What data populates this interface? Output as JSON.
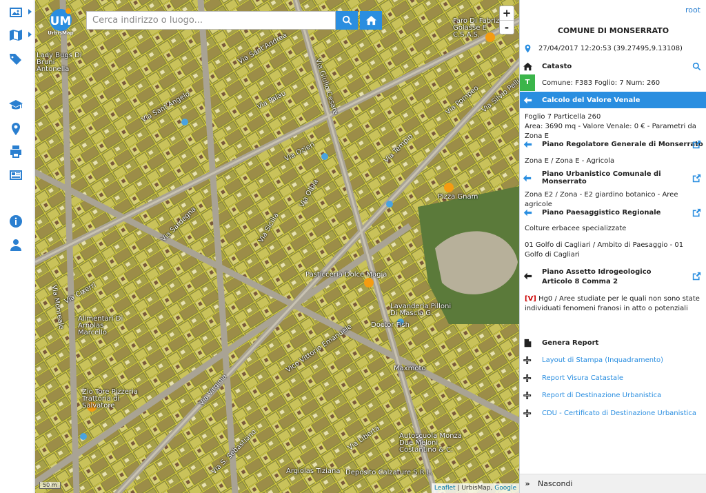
{
  "toolbar": {
    "items": [
      {
        "icon": "image-icon"
      },
      {
        "icon": "map-icon"
      },
      {
        "icon": "tags-icon"
      },
      {
        "icon": "graduation-cap-icon"
      },
      {
        "icon": "map-marker-icon"
      },
      {
        "icon": "print-icon"
      },
      {
        "icon": "newspaper-icon"
      },
      {
        "icon": "info-icon"
      },
      {
        "icon": "user-icon"
      }
    ]
  },
  "map": {
    "logo_text": "UrbisMap",
    "search_placeholder": "Cerca indirizzo o luogo...",
    "zoom_in": "+",
    "zoom_out": "-",
    "scale": "50 m",
    "attribution": {
      "leaflet": "Leaflet",
      "sep1": " | UrbisMap, ",
      "google": "Google"
    },
    "labels": [
      "Faro Di Fabrizio Golasse E C.S.A.S.",
      "Lady Bugs Di Bruni Antonella",
      "Via Giulio Cesare",
      "Via Palau",
      "Via Sant'Andrea",
      "Via Sant'Angelo",
      "Via Olbia",
      "Via Sicilia",
      "Via Ozieri",
      "Via Sardegna",
      "Via Monreale",
      "Via Cixerri",
      "Via Tempio",
      "Via Pompeo",
      "Via Silvio Pellico",
      "Pizza Gnam",
      "Pasticceria Dolce Magia",
      "Alimentari Di Arnolas Marcello",
      "Zio Tore Pizzeria Trattoria di Salvatore",
      "Via Virginia",
      "Via S. Sebastiano",
      "Doctor Fish",
      "Lavanderia Pilloni Di Mascia G.",
      "Maxmoto",
      "Autoscuola Monza Due Meloni Costantino & C.",
      "Argiolas Tiziana",
      "Deposito Calzature S.R.L.",
      "Vico Vittorio Emanuele",
      "Via Liberta"
    ]
  },
  "panel": {
    "user": "root",
    "title": "COMUNE DI MONSERRATO",
    "location": "27/04/2017 12:20:53 (39.27495,9.13108)",
    "catasto_label": "Catasto",
    "catasto_tag": "T",
    "catasto_info": "Comune: F383 Foglio: 7 Num: 260",
    "calc_label": "Calcolo del Valore Venale",
    "calc_line1": "Foglio 7 Particella 260",
    "calc_line2": "Area: 3690 mq - Valore Venale: 0 € - Parametri da Zona E",
    "prg_label": "Piano Regolatore Generale di Monserrato",
    "prg_value": "Zona E / Zona E - Agricola",
    "puc_label": "Piano Urbanistico Comunale di Monserrato",
    "puc_value": "Zona E2 / Zona - E2 giardino botanico - Aree agricole",
    "ppr_label": "Piano Paesaggistico Regionale",
    "ppr_value1": "Colture erbacee specializzate",
    "ppr_value2": "01 Golfo di Cagliari / Ambito di Paesaggio - 01 Golfo di Cagliari",
    "pai_label": "Piano Assetto Idrogeologico Articolo 8 Comma 2",
    "pai_flag": "[V]",
    "pai_value": " Hg0 / Aree studiate per le quali non sono state individuati fenomeni franosi in atto o potenziali",
    "report_label": "Genera Report",
    "reports": [
      "Layout di Stampa (Inquadramento)",
      "Report Visura Catastale",
      "Report di Destinazione Urbanistica",
      "CDU - Certificato di Destinazione Urbanistica"
    ],
    "hide_label": "Nascondi"
  }
}
